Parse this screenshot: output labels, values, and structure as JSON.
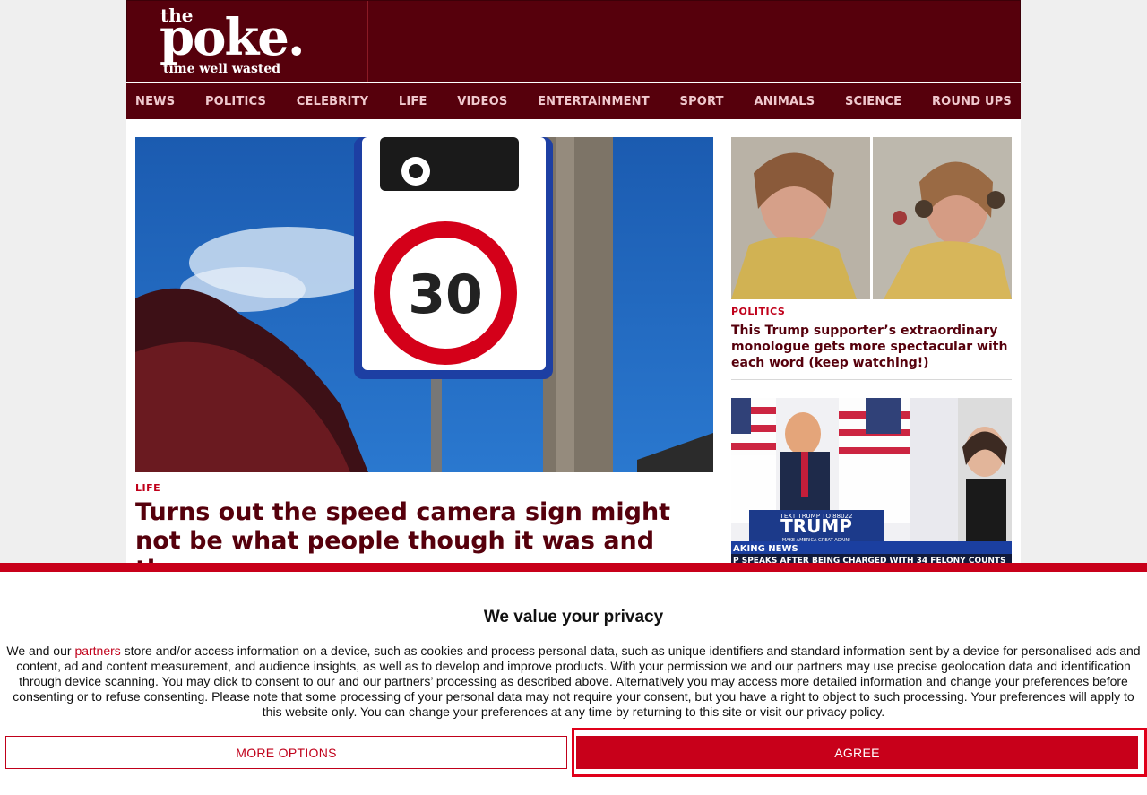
{
  "header": {
    "logo_the": "the",
    "logo_poke": "poke.",
    "logo_tagline": "time well wasted"
  },
  "nav": {
    "items": [
      "NEWS",
      "POLITICS",
      "CELEBRITY",
      "LIFE",
      "VIDEOS",
      "ENTERTAINMENT",
      "SPORT",
      "ANIMALS",
      "SCIENCE",
      "ROUND UPS"
    ]
  },
  "main_story": {
    "category": "LIFE",
    "title": "Turns out the speed camera sign might not be what people though it was and they are",
    "sign_number": "30"
  },
  "side_stories": [
    {
      "category": "POLITICS",
      "title": "This Trump supporter’s extraordinary monologue gets more spectacular with each word (keep watching!)"
    },
    {
      "banner_text": "TRUMP",
      "banner_sub": "TEXT TRUMP TO 88022",
      "banner_small": "MAKE AMERICA GREAT AGAIN!",
      "ticker_left": "AKING NEWS",
      "ticker": "P SPEAKS AFTER BEING CHARGED WITH 34 FELONY COUNTS"
    }
  ],
  "consent": {
    "title": "We value your privacy",
    "text_before_link": "We and our ",
    "link": "partners",
    "text_after_link": " store and/or access information on a device, such as cookies and process personal data, such as unique identifiers and standard information sent by a device for personalised ads and content, ad and content measurement, and audience insights, as well as to develop and improve products. With your permission we and our partners may use precise geolocation data and identification through device scanning. You may click to consent to our and our partners’ processing as described above. Alternatively you may access more detailed information and change your preferences before consenting or to refuse consenting. Please note that some processing of your personal data may not require your consent, but you have a right to object to such processing. Your preferences will apply to this website only. You can change your preferences at any time by returning to this site or visit our privacy policy.",
    "more_options": "MORE OPTIONS",
    "agree": "AGREE"
  },
  "colors": {
    "brand": "#56000c",
    "accent": "#c8001a"
  }
}
